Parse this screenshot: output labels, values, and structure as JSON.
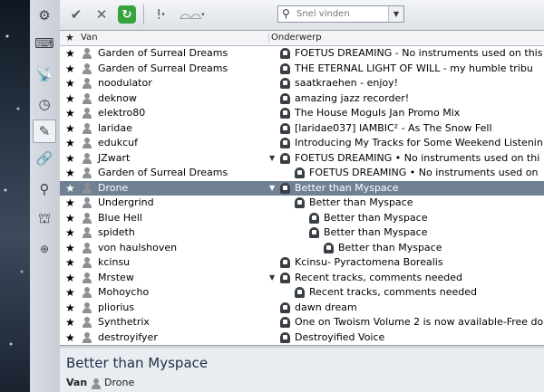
{
  "toolbar": {
    "search_placeholder": "Snel vinden",
    "icons": [
      "checkmark-icon",
      "close-icon",
      "refresh-icon",
      "exclamation-icon",
      "glasses-icon"
    ]
  },
  "sidebar": {
    "icons": [
      "gear-icon",
      "keyboard-icon",
      "satellite-icon",
      "clock-icon",
      "notes-icon",
      "link-icon",
      "search-icon",
      "binoculars-icon",
      "add-icon"
    ],
    "active_index": 4
  },
  "columns": {
    "van": "Van",
    "onderwerp": "Onderwerp"
  },
  "rows": [
    {
      "name": "Garden of Surreal Dreams",
      "subject": "FOETUS DREAMING - No instruments used on this",
      "indent": 0,
      "expander": false
    },
    {
      "name": "Garden of Surreal Dreams",
      "subject": "THE ETERNAL LIGHT OF WILL - my humble tribu",
      "indent": 0,
      "expander": false
    },
    {
      "name": "noodulator",
      "subject": "saatkraehen - enjoy!",
      "indent": 0,
      "expander": false
    },
    {
      "name": "deknow",
      "subject": "amazing jazz recorder!",
      "indent": 0,
      "expander": false
    },
    {
      "name": "elektro80",
      "subject": "The House Moguls Jan Promo Mix",
      "indent": 0,
      "expander": false
    },
    {
      "name": "laridae",
      "subject": "[laridae037] IAMBIC² - As The Snow Fell",
      "indent": 0,
      "expander": false
    },
    {
      "name": "edukcuf",
      "subject": "Introducing My Tracks for Some Weekend Listenin",
      "indent": 0,
      "expander": false
    },
    {
      "name": "JZwart",
      "subject": "FOETUS DREAMING • No instruments used on thi",
      "indent": 0,
      "expander": true
    },
    {
      "name": "Garden of Surreal Dreams",
      "subject": "FOETUS DREAMING • No instruments used on",
      "indent": 1,
      "expander": false
    },
    {
      "name": "Drone",
      "subject": "Better than Myspace",
      "indent": 0,
      "expander": true,
      "selected": true
    },
    {
      "name": "Undergrind",
      "subject": "Better than Myspace",
      "indent": 1,
      "expander": false
    },
    {
      "name": "Blue Hell",
      "subject": "Better than Myspace",
      "indent": 2,
      "expander": false
    },
    {
      "name": "spideth",
      "subject": "Better than Myspace",
      "indent": 2,
      "expander": false
    },
    {
      "name": "von haulshoven",
      "subject": "Better than Myspace",
      "indent": 3,
      "expander": false
    },
    {
      "name": "kcinsu",
      "subject": "Kcinsu- Pyractomena Borealis",
      "indent": 0,
      "expander": false
    },
    {
      "name": "Mrstew",
      "subject": "Recent tracks, comments needed",
      "indent": 0,
      "expander": true
    },
    {
      "name": "Mohoycho",
      "subject": "Recent tracks, comments needed",
      "indent": 1,
      "expander": false
    },
    {
      "name": "pliorius",
      "subject": "dawn dream",
      "indent": 0,
      "expander": false
    },
    {
      "name": "Synthetrix",
      "subject": "One on Twoism Volume 2 is now available-Free do",
      "indent": 0,
      "expander": false
    },
    {
      "name": "destroyifyer",
      "subject": "Destroyified Voice",
      "indent": 0,
      "expander": false
    }
  ],
  "preview": {
    "title": "Better than Myspace",
    "van_label": "Van",
    "from": "Drone"
  }
}
